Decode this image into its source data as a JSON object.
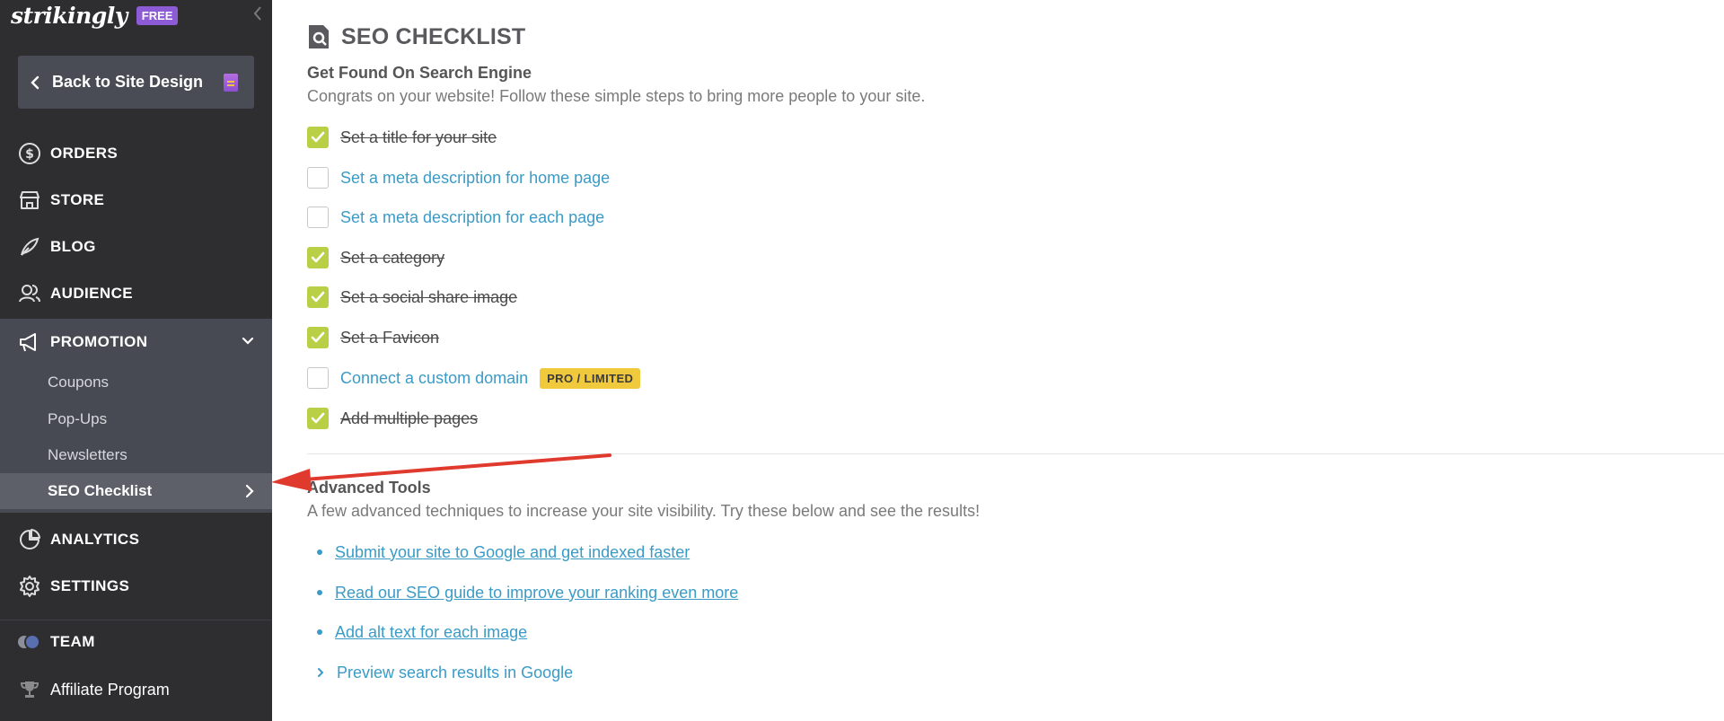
{
  "sidebar": {
    "logo": "strikingly",
    "plan_badge": "FREE",
    "back_button": "Back to Site Design",
    "nav": {
      "orders": "ORDERS",
      "store": "STORE",
      "blog": "BLOG",
      "audience": "AUDIENCE",
      "promotion": "PROMOTION",
      "analytics": "ANALYTICS",
      "settings": "SETTINGS",
      "team": "TEAM",
      "affiliate": "Affiliate Program"
    },
    "promotion_items": [
      "Coupons",
      "Pop-Ups",
      "Newsletters",
      "SEO Checklist"
    ]
  },
  "main": {
    "title": "SEO CHECKLIST",
    "section1": {
      "title": "Get Found On Search Engine",
      "desc": "Congrats on your website! Follow these simple steps to bring more people to your site.",
      "items": [
        {
          "label": "Set a title for your site",
          "done": true
        },
        {
          "label": "Set a meta description for home page",
          "done": false
        },
        {
          "label": "Set a meta description for each page",
          "done": false
        },
        {
          "label": "Set a category",
          "done": true
        },
        {
          "label": "Set a social share image",
          "done": true
        },
        {
          "label": "Set a Favicon",
          "done": true
        },
        {
          "label": "Connect a custom domain",
          "done": false,
          "badge": "PRO / LIMITED"
        },
        {
          "label": "Add multiple pages",
          "done": true
        }
      ]
    },
    "section2": {
      "title": "Advanced Tools",
      "desc": "A few advanced techniques to increase your site visibility. Try these below and see the results!",
      "links": [
        "Submit your site to Google and get indexed faster",
        "Read our SEO guide to improve your ranking even more",
        "Add alt text for each image"
      ],
      "preview": "Preview search results in Google"
    }
  },
  "colors": {
    "sidebar_bg": "#2e2e30",
    "promotion_bg": "#474a52",
    "active_bg": "#5d6069",
    "check_green": "#b9cf45",
    "link_blue": "#3a9bc6",
    "badge_yellow": "#f0c93c",
    "free_purple": "#8e5bd7",
    "annotation_red": "#e03a2f"
  }
}
